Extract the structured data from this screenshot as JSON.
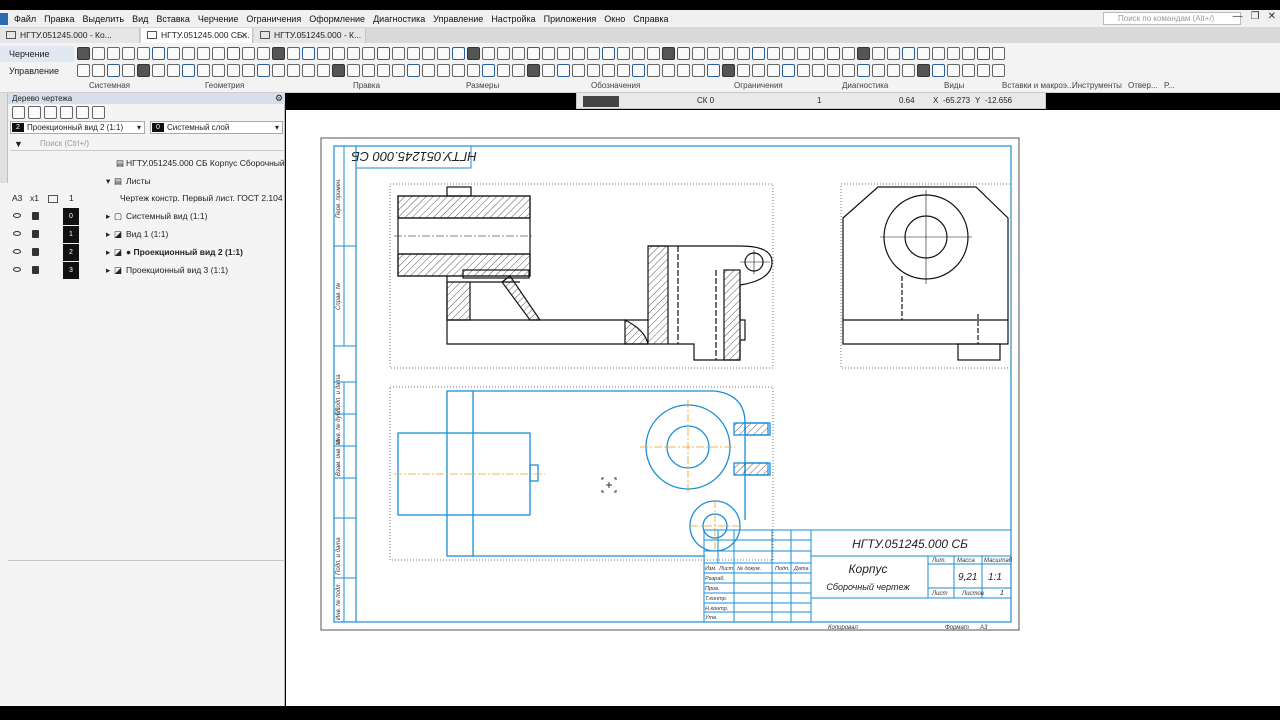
{
  "menu": [
    "Файл",
    "Правка",
    "Выделить",
    "Вид",
    "Вставка",
    "Черчение",
    "Ограничения",
    "Оформление",
    "Диагностика",
    "Управление",
    "Настройка",
    "Приложения",
    "Окно",
    "Справка"
  ],
  "search_placeholder": "Поиск по командам (Alt+/)",
  "tabs": [
    "НГТУ.051245.000 - Ко...",
    "НГТУ.051245.000 СБ...",
    "НГТУ.051245.000 - К..."
  ],
  "ribbon": {
    "modes": [
      "Черчение",
      "Управление"
    ],
    "groups": [
      "Системная",
      "Геометрия",
      "Правка",
      "Размеры",
      "Обозначения",
      "Ограничения",
      "Диагностика",
      "Виды",
      "Вставки и макроэ...",
      "Инструменты",
      "Отвер...",
      "Р..."
    ]
  },
  "settings_bar": {
    "layer_style": "СК 0",
    "scale": "1",
    "zoom": "0.64",
    "x_label": "X",
    "x_value": "-65.273",
    "y_label": "Y",
    "y_value": "-12.656"
  },
  "panel": {
    "title": "Дерево чертежа",
    "view_num": "2",
    "view_select": "Проекционный вид 2 (1:1)",
    "layer_num": "0",
    "layer_select": "Системный слой",
    "search_placeholder": "Поиск (Ctrl+/)",
    "document": "НГТУ.051245.000 СБ Корпус Сборочный",
    "sheets_label": "Листы",
    "sheet_item": "Чертеж констр. Первый лист. ГОСТ 2.104",
    "sheet_format": "А3",
    "sheet_mult": "x1",
    "sheet_count": "1",
    "views": [
      {
        "num": "0",
        "label": "Системный вид (1:1)",
        "bold": false
      },
      {
        "num": "1",
        "label": "Вид 1 (1:1)",
        "bold": false
      },
      {
        "num": "2",
        "label": "● Проекционный вид 2 (1:1)",
        "bold": true
      },
      {
        "num": "3",
        "label": "Проекционный вид 3 (1:1)",
        "bold": false
      }
    ]
  },
  "drawing": {
    "rotated_designation": "НГТУ.051245.000 СБ",
    "designation": "НГТУ.051245.000 СБ",
    "name": "Корпус",
    "doc_type": "Сборочный чертеж",
    "lit_label": "Лит.",
    "mass_label": "Масса",
    "scale_label": "Масштаб",
    "mass": "9,21",
    "scale": "1:1",
    "sheet_label": "Лист",
    "sheets_label": "Листов",
    "sheets_count": "1",
    "copied_label": "Копировал",
    "format_label": "Формат",
    "format_value": "А3",
    "side_labels": [
      "Перв. примен.",
      "Справ. №",
      "Подп. и дата",
      "Инв. № дубл.",
      "Взам. инв. №",
      "Подп. и дата",
      "Инв. № подл."
    ],
    "table_headers": [
      "Изм.",
      "Лист",
      "№ докум.",
      "Подп.",
      "Дата"
    ],
    "roles": [
      "Разраб.",
      "Пров.",
      "Т.контр.",
      "",
      "Н.контр.",
      "Утв."
    ]
  },
  "colors": {
    "view_outline": "#1a8fd6",
    "frame": "#1a8fd6",
    "axis": "#e8a020"
  }
}
